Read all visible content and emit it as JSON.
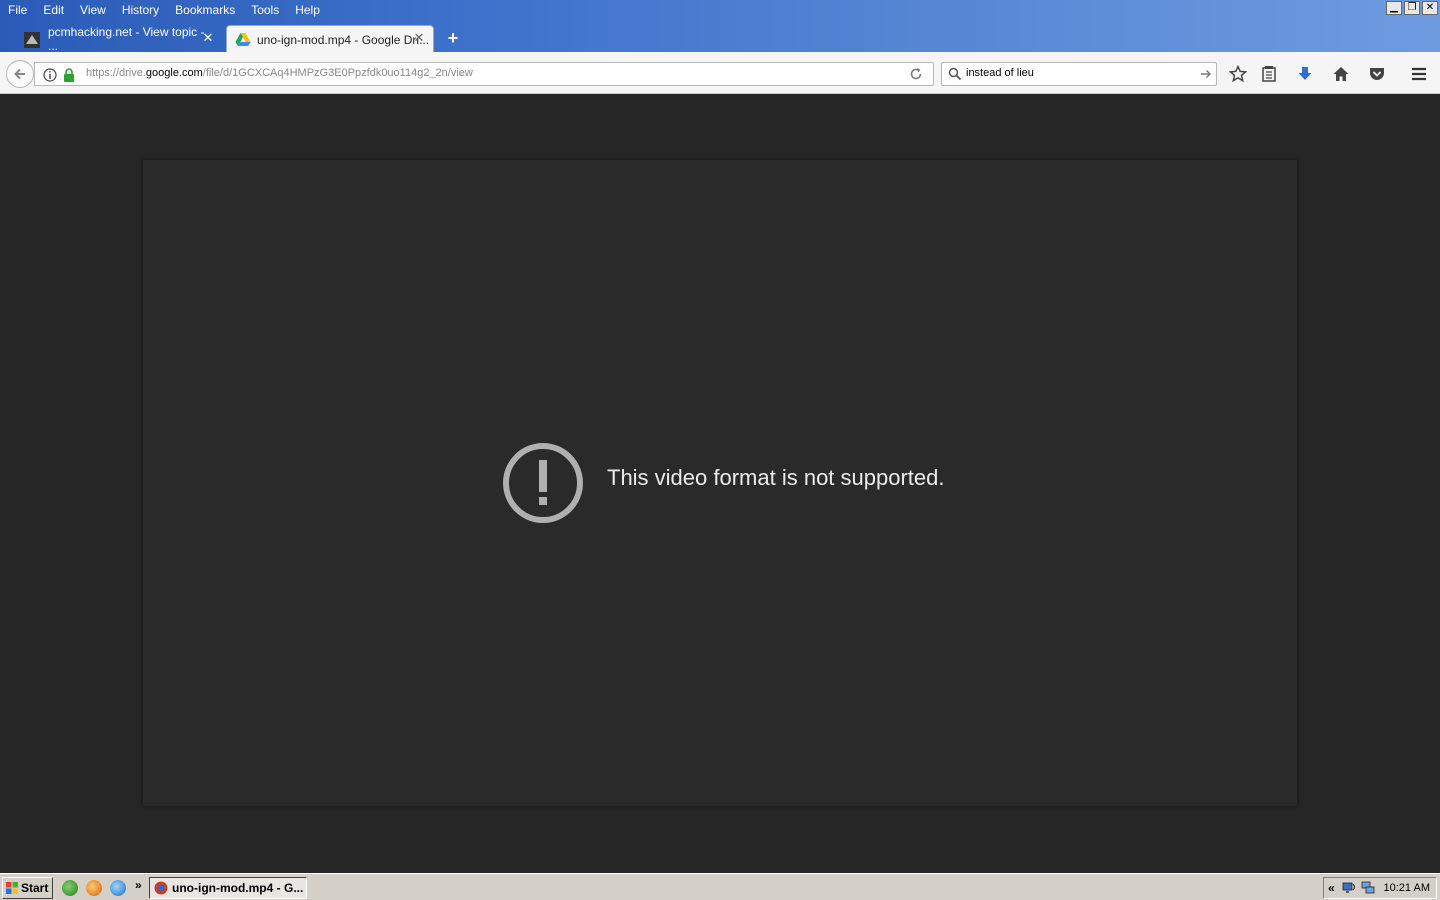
{
  "menubar": {
    "items": [
      "File",
      "Edit",
      "View",
      "History",
      "Bookmarks",
      "Tools",
      "Help"
    ]
  },
  "window_controls": {
    "minimize": "minimize-icon",
    "restore": "restore-icon",
    "close": "close-icon"
  },
  "tabs": [
    {
      "title": "pcmhacking.net - View topic - ...",
      "active": false,
      "icon": "pcmhacking-favicon"
    },
    {
      "title": "uno-ign-mod.mp4 - Google Dri...",
      "active": true,
      "icon": "google-drive-icon"
    }
  ],
  "navbar": {
    "url_prefix": "https://drive.",
    "url_host": "google.com",
    "url_suffix": "/file/d/1GCXCAq4HMPzG3E0Ppzfdk0uo114g2_2n/view",
    "search_value": "instead of lieu"
  },
  "content": {
    "error_message": "This video format is not supported."
  },
  "taskbar": {
    "start_label": "Start",
    "more_label": "»",
    "task_label": "uno-ign-mod.mp4 - G...",
    "tray_arrows": "«",
    "clock": "10:21 AM"
  },
  "colors": {
    "background": "#262626",
    "panel": "#2a2a2a",
    "titlebar": "#3f73cc",
    "taskbar": "#d4d0c8"
  }
}
